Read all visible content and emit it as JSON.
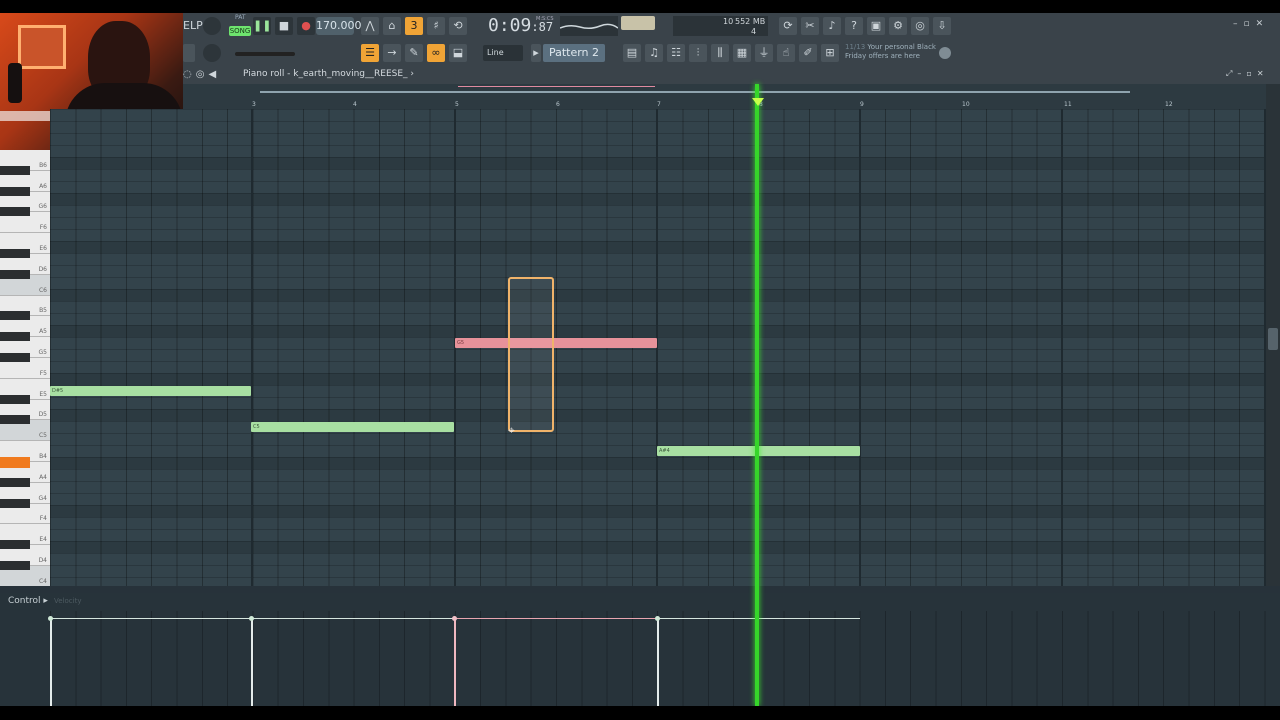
{
  "toolbar": {
    "menu_fragment": "ELP",
    "song_mode": "SONG",
    "pattern_mode_label": "PAT",
    "tempo": "170.000",
    "time_display": "0:09",
    "time_centis": "87",
    "time_unit": "M:S:CS",
    "cpu_value": "10",
    "memory": "552 MB",
    "voices": "4",
    "snap_mode": "Line",
    "pattern_name": "Pattern 2",
    "news_count": "11/13",
    "news_text_1": "Your personal Black",
    "news_text_2": "Friday offers are here",
    "accent_color": "#f0a436",
    "song_color": "#6ee46e"
  },
  "piano_roll": {
    "title": "Piano roll - k_earth_moving__REESE_",
    "title_arrow": "›",
    "bar_numbers": [
      "3",
      "4",
      "5",
      "6",
      "7",
      "8",
      "9",
      "10",
      "11",
      "12"
    ],
    "key_labels": [
      "B6",
      "A6",
      "G6",
      "F6",
      "E6",
      "D6",
      "C6",
      "B5",
      "A5",
      "G5",
      "F5",
      "E5",
      "D5",
      "C5",
      "B4",
      "A4",
      "G4",
      "F4",
      "E4",
      "D4",
      "C4"
    ],
    "notes": [
      {
        "label": "D#5",
        "color": "green",
        "pitch": "D#5"
      },
      {
        "label": "C5",
        "color": "green",
        "pitch": "C5"
      },
      {
        "label": "G5",
        "color": "pink",
        "pitch": "G5"
      },
      {
        "label": "A#4",
        "color": "green",
        "pitch": "A#4"
      }
    ],
    "playhead_color": "#36d62a"
  },
  "control": {
    "label": "Control",
    "arrow": "▸",
    "property": "Velocity"
  }
}
